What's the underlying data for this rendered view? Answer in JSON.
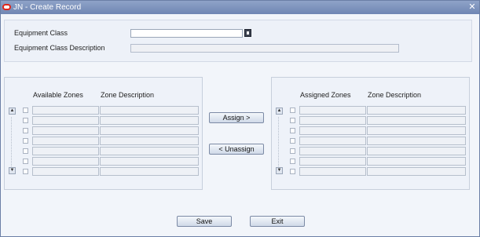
{
  "window": {
    "title": "JN - Create Record",
    "close_glyph": "✕"
  },
  "form": {
    "equipment_class_label": "Equipment Class",
    "equipment_class_value": "",
    "equipment_class_description_label": "Equipment Class Description",
    "equipment_class_description_value": ""
  },
  "available": {
    "col_zones": "Available Zones",
    "col_description": "Zone Description"
  },
  "assigned": {
    "col_zones": "Assigned Zones",
    "col_description": "Zone Description"
  },
  "actions": {
    "assign_label": "Assign >",
    "unassign_label": "< Unassign",
    "save_label": "Save",
    "exit_label": "Exit"
  },
  "icons": {
    "lov": "list-of-values-icon",
    "scroll_up": "scroll-up-arrow-icon",
    "scroll_down": "scroll-down-arrow-icon",
    "close": "close-icon",
    "logo": "oracle-logo-icon"
  },
  "colors": {
    "titlebar": "#7a8fba",
    "background": "#f2f5fa",
    "logo": "#e0261b"
  }
}
